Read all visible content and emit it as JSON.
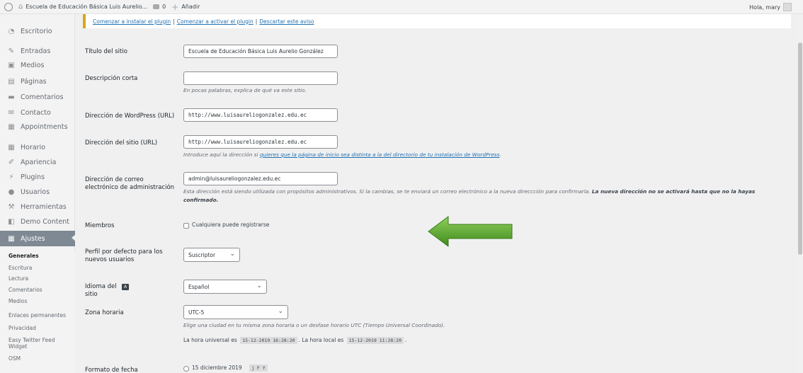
{
  "adminbar": {
    "site_name": "Escuela de Educación Básica Luis Aurelio...",
    "comments_count": "0",
    "new_label": "Añadir",
    "greeting": "Hola, mary"
  },
  "sidebar": {
    "items": [
      {
        "label": "Escritorio",
        "icon": "dashboard-icon"
      },
      {
        "label": "Entradas",
        "icon": "pin-icon"
      },
      {
        "label": "Medios",
        "icon": "media-icon"
      },
      {
        "label": "Páginas",
        "icon": "page-icon"
      },
      {
        "label": "Comentarios",
        "icon": "comment-icon"
      },
      {
        "label": "Contacto",
        "icon": "mail-icon"
      },
      {
        "label": "Appointments",
        "icon": "calendar-icon"
      },
      {
        "label": "Horario",
        "icon": "calendar-icon"
      },
      {
        "label": "Apariencia",
        "icon": "brush-icon"
      },
      {
        "label": "Plugins",
        "icon": "plug-icon"
      },
      {
        "label": "Usuarios",
        "icon": "user-icon"
      },
      {
        "label": "Herramientas",
        "icon": "wrench-icon"
      },
      {
        "label": "Demo Content",
        "icon": "demo-icon"
      },
      {
        "label": "Ajustes",
        "icon": "settings-icon"
      }
    ],
    "submenu": [
      "Generales",
      "Escritura",
      "Lectura",
      "Comentarios",
      "Medios",
      "Enlaces permanentes",
      "Privacidad",
      "Easy Twitter Feed Widget",
      "OSM"
    ]
  },
  "notice": {
    "install": "Comenzar a instalar el plugin",
    "activate": "Comenzar a activar el plugin",
    "dismiss": "Descartar este aviso",
    "sep": "|"
  },
  "form": {
    "site_title_label": "Título del sitio",
    "site_title_value": "Escuela de Educación Básica Luis Aurelio González",
    "tagline_label": "Descripción corta",
    "tagline_value": "",
    "tagline_desc": "En pocas palabras, explica de qué va este sitio.",
    "wp_url_label": "Dirección de WordPress (URL)",
    "wp_url_value": "http://www.luisaureliogonzalez.edu.ec",
    "site_url_label": "Dirección del sitio (URL)",
    "site_url_value": "http://www.luisaureliogonzalez.edu.ec",
    "site_url_desc_pre": "Introduce aquí la dirección si ",
    "site_url_desc_link": "quieres que la página de inicio sea distinta a la del directorio de tu instalación de WordPress",
    "site_url_desc_post": ".",
    "email_label": "Dirección de correo electrónico de administración",
    "email_value": "admin@luisaureliogonzalez.edu.ec",
    "email_desc": "Esta dirección está siendo utilizada con propósitos administrativos. Si la cambias, se te enviará un correo electrónico a la nueva direccción para confirmarla.",
    "email_desc_bold": "La nueva dirección no se activará hasta que no la hayas confirmado.",
    "members_label": "Miembros",
    "members_checkbox": "Cualquiera puede registrarse",
    "role_label": "Perfil por defecto para los nuevos usuarios",
    "role_value": "Suscriptor",
    "language_label": "Idioma del sitio",
    "language_value": "Español",
    "timezone_label": "Zona horaria",
    "timezone_value": "UTC-5",
    "timezone_desc": "Elige una ciudad en tu misma zona horaria o un desfase horario UTC (Tiempo Universal Coordinado).",
    "utc_pre": "La hora universal es",
    "utc_time": "15-12-2019 16:28:20",
    "local_pre": ". La hora local es",
    "local_time": "15-12-2019 11:28:20",
    "local_post": ".",
    "date_format_label": "Formato de fecha",
    "date_format_option": "15 diciembre 2019",
    "date_format_code": "j F Y"
  },
  "colors": {
    "arrow": "#5aa02c",
    "link": "#2271b1",
    "notice_border": "#dba617",
    "active_menu": "#7e8993"
  }
}
